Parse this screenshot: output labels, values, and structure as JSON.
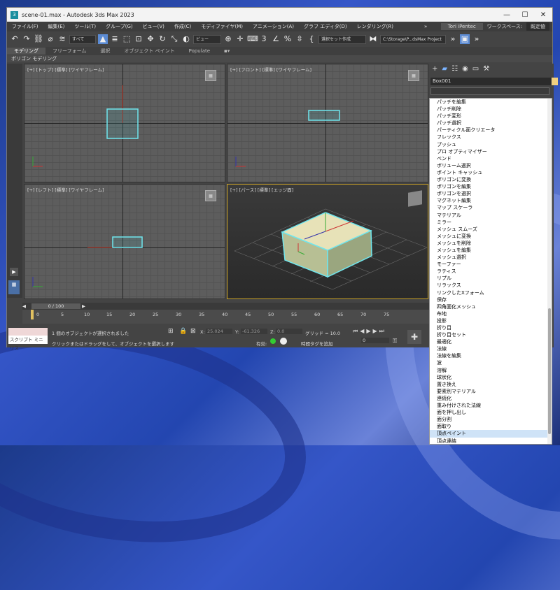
{
  "window": {
    "title": "scene-01.max - Autodesk 3ds Max 2023",
    "minimize": "—",
    "maximize": "☐",
    "close": "✕"
  },
  "menu": {
    "items": [
      "ファイル(F)",
      "編集(E)",
      "ツール(T)",
      "グループ(G)",
      "ビュー(V)",
      "作成(C)",
      "モディファイヤ(M)",
      "アニメーション(A)",
      "グラフ エディタ(D)",
      "レンダリング(R)"
    ],
    "more": "»",
    "user": "Tori iPentec",
    "workspace_label": "ワークスペース:",
    "workspace_value": "既定値"
  },
  "toolbar": {
    "filter_all": "すべて",
    "view": "ビュー",
    "selection_set": "選択セット作成",
    "project_path": "C:\\Storage\\P...dsMax Project"
  },
  "ribbon": {
    "tabs": [
      "モデリング",
      "フリーフォーム",
      "選択",
      "オブジェクト ペイント",
      "Populate"
    ],
    "sub": "ポリゴン モデリング"
  },
  "viewports": {
    "top": "[+] [トップ] [標準] [ワイヤフレーム]",
    "front": "[+] [フロント] [標準] [ワイヤフレーム]",
    "left": "[+] [レフト] [標準] [ワイヤフレーム]",
    "persp": "[+] [パース] [標準] [エッジ面]"
  },
  "command_panel": {
    "object_name": "Box001"
  },
  "timeline": {
    "frame": "0 / 100",
    "ticks": [
      "0",
      "5",
      "10",
      "15",
      "20",
      "25",
      "30",
      "35",
      "40",
      "45",
      "50",
      "55",
      "60",
      "65",
      "70",
      "75"
    ]
  },
  "status": {
    "listener": "スクリプト ミニ リス",
    "selected": "1 個のオブジェクトが選択されました",
    "prompt": "クリックまたはドラッグをして、オブジェクトを選択します",
    "x_label": "X:",
    "x_value": "25.024",
    "y_label": "Y:",
    "y_value": "-61.326",
    "z_label": "Z:",
    "z_value": "0.0",
    "grid": "グリッド = 10.0",
    "enabled": "有効:",
    "time_tag": "時間タグを追加",
    "frame_field": "0"
  },
  "modifiers": [
    "パッチを編集",
    "パッチ削除",
    "パッチ変形",
    "パッチ選択",
    "パーティクル面クリエータ",
    "フレックス",
    "プッシュ",
    "プロ オプティマイザー",
    "ベンド",
    "ボリューム選択",
    "ポイント キャッシュ",
    "ポリゴンに変換",
    "ポリゴンを編集",
    "ポリゴンを選択",
    "マグネット編集",
    "マップ スケーラ",
    "マテリアル",
    "ミラー",
    "メッシュ スムーズ",
    "メッシュに変換",
    "メッシュを削除",
    "メッシュを編集",
    "メッシュ選択",
    "モーファー",
    "ラティス",
    "リプル",
    "リラックス",
    "リンクしたXフォーム",
    "保存",
    "四角面化メッシュ",
    "布地",
    "投影",
    "折り目",
    "折り目セット",
    "最適化",
    "法線",
    "法線を編集",
    "波",
    "溶解",
    "球状化",
    "置き換え",
    "要素別マテリアル",
    "連続化",
    "重み付けされた法線",
    "面を押し出し",
    "面分割",
    "面取り",
    "頂点ペイント",
    "頂点連結"
  ],
  "selected_modifier": "頂点ペイント"
}
